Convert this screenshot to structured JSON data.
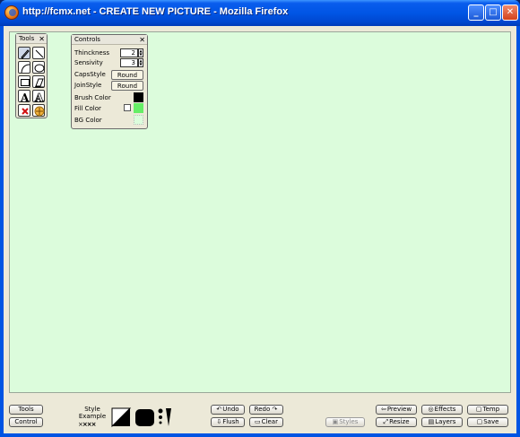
{
  "window": {
    "title": "http://fcmx.net - CREATE NEW PICTURE - Mozilla Firefox",
    "minimize": "_",
    "maximize": "□",
    "close": "✕"
  },
  "canvas": {
    "background_color": "#dcfcdc"
  },
  "tools_panel": {
    "title": "Tools",
    "close": "✕",
    "tools": [
      "pencil-tool",
      "line-tool",
      "curve-tool",
      "ellipse-tool",
      "rectangle-tool",
      "eraser-tool",
      "text-tool",
      "outline-text-tool",
      "clear-tool",
      "move-tool"
    ]
  },
  "controls_panel": {
    "title": "Controls",
    "close": "✕",
    "thickness_label": "Thinckness",
    "thickness_value": "2",
    "sensitivity_label": "Sensivity",
    "sensitivity_value": "3",
    "caps_label": "CapsStyle",
    "caps_value": "Round",
    "join_label": "JoinStyle",
    "join_value": "Round",
    "brush_label": "Brush Color",
    "brush_color": "#000000",
    "fill_label": "Fill Color",
    "fill_color": "#66ee66",
    "bg_label": "BG Color",
    "bg_color": "#dcfcdc"
  },
  "bottom": {
    "tools_label": "Tools",
    "control_label": "Control",
    "style_label": "Style",
    "example_label": "Example",
    "undo": "Undo",
    "redo": "Redo",
    "flush": "Flush",
    "clear": "Clear",
    "styles": "Styles",
    "preview": "Preview",
    "effects": "Effects",
    "temp": "Temp",
    "resize": "Resize",
    "layers": "Layers",
    "save": "Save"
  }
}
